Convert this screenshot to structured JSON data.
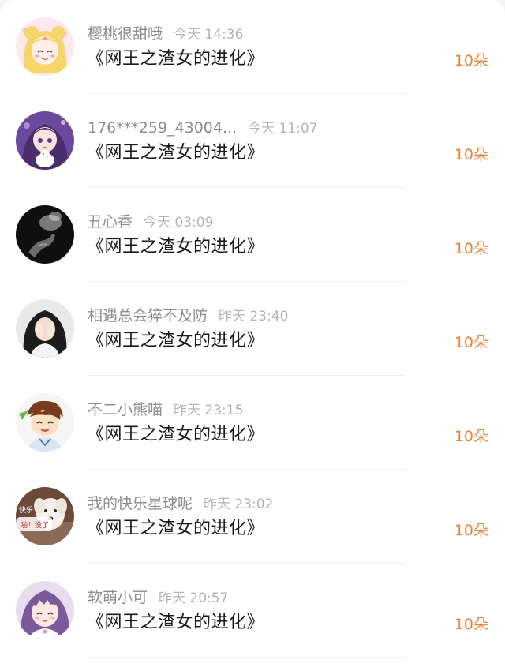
{
  "gift_list": {
    "items": [
      {
        "username": "樱桃很甜哦",
        "time": "今天 14:36",
        "title": "《网王之渣女的进化》",
        "amount": "10朵",
        "avatar": "sailor-moon-avatar-icon"
      },
      {
        "username": "176***259_43004...",
        "time": "今天 11:07",
        "title": "《网王之渣女的进化》",
        "amount": "10朵",
        "avatar": "doll-girl-avatar-icon"
      },
      {
        "username": "丑心香",
        "time": "今天 03:09",
        "title": "《网王之渣女的进化》",
        "amount": "10朵",
        "avatar": "dark-photo-avatar-icon"
      },
      {
        "username": "相遇总会猝不及防",
        "time": "昨天 23:40",
        "title": "《网王之渣女的进化》",
        "amount": "10朵",
        "avatar": "girl-covering-face-avatar-icon"
      },
      {
        "username": "不二小熊喵",
        "time": "昨天 23:15",
        "title": "《网王之渣女的进化》",
        "amount": "10朵",
        "avatar": "anime-boy-avatar-icon"
      },
      {
        "username": "我的快乐星球呢",
        "time": "昨天 23:02",
        "title": "《网王之渣女的进化》",
        "amount": "10朵",
        "avatar": "dog-meme-avatar-icon",
        "avatar_text": [
          "快乐",
          "啪！没了"
        ]
      },
      {
        "username": "软萌小可",
        "time": "昨天 20:57",
        "title": "《网王之渣女的进化》",
        "amount": "10朵",
        "avatar": "purple-hair-girl-avatar-icon"
      }
    ]
  },
  "colors": {
    "amount": "#e8853d",
    "title": "#1a1a1a",
    "username": "#8c8c8c",
    "time": "#b4b4b4"
  }
}
